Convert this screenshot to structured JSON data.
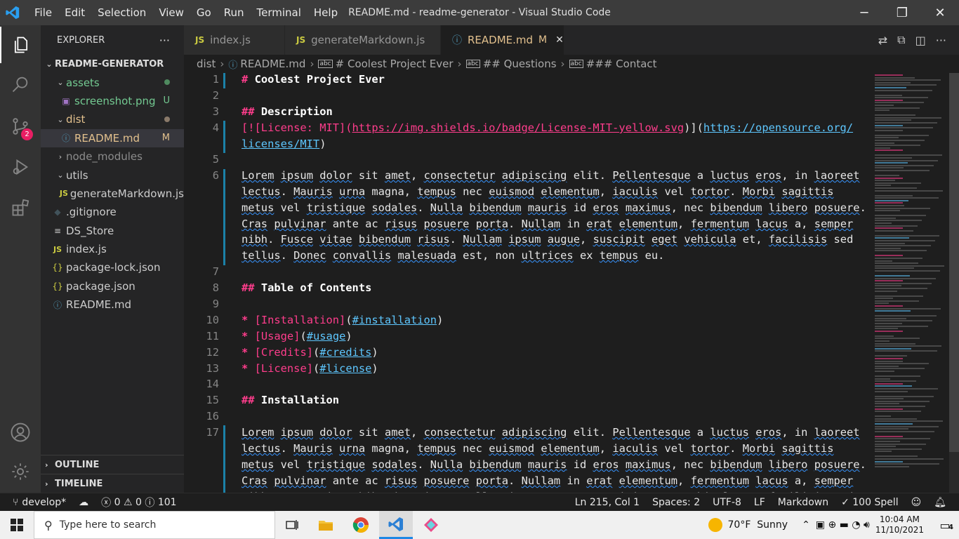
{
  "window": {
    "title": "README.md - readme-generator - Visual Studio Code"
  },
  "menu": [
    "File",
    "Edit",
    "Selection",
    "View",
    "Go",
    "Run",
    "Terminal",
    "Help"
  ],
  "activity": {
    "scm_badge": "2"
  },
  "explorer": {
    "title": "EXPLORER",
    "more": "···",
    "root": "README-GENERATOR",
    "items": [
      {
        "label": "assets",
        "status": "",
        "color": "#73c991"
      },
      {
        "label": "screenshot.png",
        "status": "U",
        "color": "#73c991"
      },
      {
        "label": "dist",
        "status": "",
        "color": "#cccccc"
      },
      {
        "label": "README.md",
        "status": "M",
        "color": "#cccccc"
      },
      {
        "label": "node_modules",
        "status": "",
        "color": "#8c8c8c"
      },
      {
        "label": "utils",
        "status": "",
        "color": "#cccccc"
      },
      {
        "label": "generateMarkdown.js",
        "status": "",
        "color": "#cccccc"
      },
      {
        "label": ".gitignore",
        "status": "",
        "color": "#cccccc"
      },
      {
        "label": "DS_Store",
        "status": "",
        "color": "#cccccc"
      },
      {
        "label": "index.js",
        "status": "",
        "color": "#cccccc"
      },
      {
        "label": "package-lock.json",
        "status": "",
        "color": "#cccccc"
      },
      {
        "label": "package.json",
        "status": "",
        "color": "#cccccc"
      },
      {
        "label": "README.md",
        "status": "",
        "color": "#cccccc"
      }
    ],
    "outline": "OUTLINE",
    "timeline": "TIMELINE"
  },
  "tabs": [
    {
      "label": "index.js",
      "icon": "JS",
      "mod": ""
    },
    {
      "label": "generateMarkdown.js",
      "icon": "JS",
      "mod": ""
    },
    {
      "label": "README.md",
      "icon": "ⓘ",
      "mod": "M"
    }
  ],
  "breadcrumb": [
    "dist",
    "README.md",
    "# Coolest Project Ever",
    "## Questions",
    "### Contact"
  ],
  "editor": {
    "lines": {
      "l1": "Coolest Project Ever",
      "l3": "Description",
      "l4a": "[![License: MIT](",
      "l4b": "https://img.shields.io/badge/License-MIT-yellow.svg",
      "l4c": ")](",
      "l4d": "https://opensource.org/",
      "l4e": "licenses/MIT",
      "l4f": ")",
      "lorem1": "Lorem ipsum dolor sit amet, consectetur adipiscing elit. Pellentesque a luctus eros, in laoreet",
      "lorem2": "lectus. Mauris urna magna, tempus nec euismod elementum, iaculis vel tortor. Morbi sagittis",
      "lorem3": "metus vel tristique sodales. Nulla bibendum mauris id eros maximus, nec bibendum libero posuere.",
      "lorem4": "Cras pulvinar ante ac risus posuere porta. Nullam in erat elementum, fermentum lacus a, semper",
      "lorem5": "nibh. Fusce vitae bibendum risus. Nullam ipsum augue, suscipit eget vehicula et, facilisis sed",
      "lorem6": "tellus. Donec convallis malesuada est, non ultrices ex tempus eu.",
      "l8": "Table of Contents",
      "toc": [
        {
          "text": "Installation",
          "link": "#installation"
        },
        {
          "text": "Usage",
          "link": "#usage"
        },
        {
          "text": "Credits",
          "link": "#credits"
        },
        {
          "text": "License",
          "link": "#license"
        }
      ],
      "l15": "Installation"
    },
    "line_numbers": [
      "1",
      "2",
      "3",
      "4",
      "5",
      "6",
      "7",
      "8",
      "9",
      "10",
      "11",
      "12",
      "13",
      "14",
      "15",
      "16",
      "17"
    ]
  },
  "status": {
    "branch": "develop*",
    "errors": "0",
    "warnings": "0",
    "info": "101",
    "position": "Ln 215, Col 1",
    "spaces": "Spaces: 2",
    "encoding": "UTF-8",
    "eol": "LF",
    "language": "Markdown",
    "spell": "100 Spell"
  },
  "taskbar": {
    "search_placeholder": "Type here to search",
    "weather": "70°F  Sunny",
    "time": "10:04 AM",
    "date": "11/10/2021",
    "notifications": "4"
  }
}
